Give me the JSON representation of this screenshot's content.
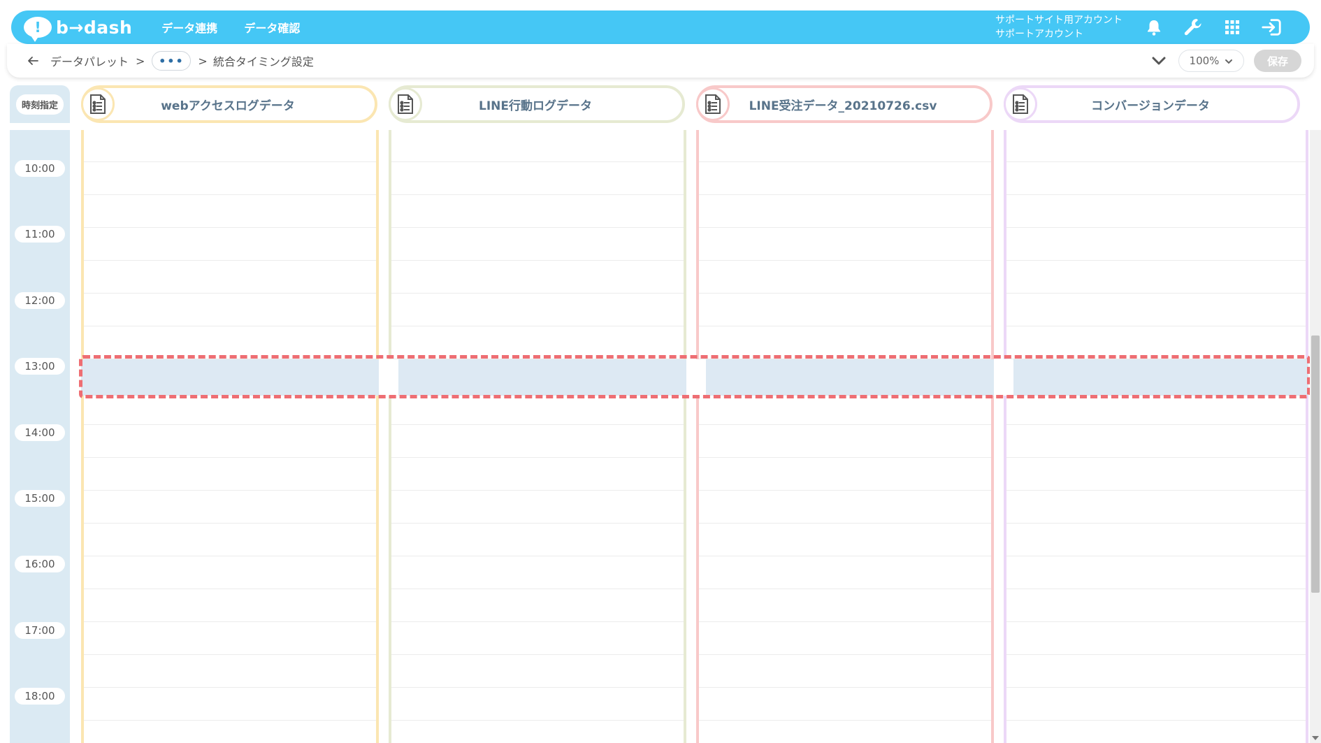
{
  "app": {
    "logo_mark": "!",
    "logo_text": "b→dash",
    "nav": [
      "データ連携",
      "データ確認"
    ],
    "account_line1": "サポートサイト用アカウント",
    "account_line2": "サポートアカウント",
    "icons": [
      "bell-icon",
      "wrench-icon",
      "grid-icon",
      "logout-icon"
    ]
  },
  "breadcrumb": {
    "root": "データパレット",
    "sep": ">",
    "more": "•••",
    "current": "統合タイミング設定"
  },
  "toolbar": {
    "zoom": "100%",
    "save_label": "保存"
  },
  "timeline": {
    "header_label": "時刻指定",
    "columns": [
      {
        "label": "webアクセスログデータ",
        "color": "#fbe6b2"
      },
      {
        "label": "LINE行動ログデータ",
        "color": "#e6ead2"
      },
      {
        "label": "LINE受注データ_20210726.csv",
        "color": "#f8c9c9"
      },
      {
        "label": "コンバージョンデータ",
        "color": "#ecd8f7"
      }
    ],
    "times": [
      "10:00",
      "11:00",
      "12:00",
      "13:00",
      "14:00",
      "15:00",
      "16:00",
      "17:00",
      "18:00"
    ],
    "highlight_time": "13:00",
    "highlight_color": "#ee6e73"
  }
}
